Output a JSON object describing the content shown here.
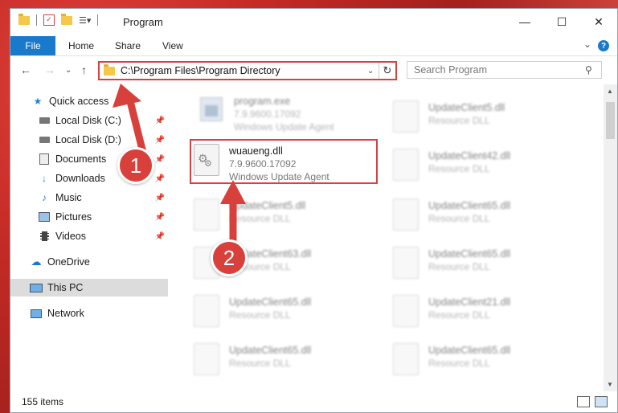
{
  "window": {
    "title": "Program"
  },
  "ribbon": {
    "file": "File",
    "home": "Home",
    "share": "Share",
    "view": "View",
    "help": "?"
  },
  "address": {
    "path": "C:\\Program Files\\Program Directory"
  },
  "search": {
    "placeholder": "Search Program"
  },
  "sidebar": {
    "items": [
      {
        "label": "Quick access"
      },
      {
        "label": "Local Disk (C:)"
      },
      {
        "label": "Local Disk (D:)"
      },
      {
        "label": "Documents"
      },
      {
        "label": "Downloads"
      },
      {
        "label": "Music"
      },
      {
        "label": "Pictures"
      },
      {
        "label": "Videos"
      },
      {
        "label": "OneDrive"
      },
      {
        "label": "This PC"
      },
      {
        "label": "Network"
      }
    ]
  },
  "files": {
    "left": [
      {
        "name": "program.exe",
        "line2": "7.9.9600.17092",
        "line3": "Windows Update Agent"
      },
      {
        "name": "wuaueng.dll",
        "line2": "7.9.9600.17092",
        "line3": "Windows Update Agent"
      },
      {
        "name": "UpdateClient5.dll",
        "line2": "Resource DLL"
      },
      {
        "name": "UpdateClient63.dll",
        "line2": "Resource DLL"
      },
      {
        "name": "UpdateClient65.dll",
        "line2": "Resource DLL"
      },
      {
        "name": "UpdateClient65.dll",
        "line2": "Resource DLL"
      }
    ],
    "right": [
      {
        "name": "UpdateClient5.dll",
        "line2": "Resource DLL"
      },
      {
        "name": "UpdateClient42.dll",
        "line2": "Resource DLL"
      },
      {
        "name": "UpdateClient65.dll",
        "line2": "Resource DLL"
      },
      {
        "name": "UpdateClient65.dll",
        "line2": "Resource DLL"
      },
      {
        "name": "UpdateClient21.dll",
        "line2": "Resource DLL"
      },
      {
        "name": "UpdateClient65.dll",
        "line2": "Resource DLL"
      }
    ]
  },
  "status": {
    "count": "155 items"
  },
  "annotations": {
    "step1": "1",
    "step2": "2"
  },
  "colors": {
    "accent": "#1979ca",
    "highlight": "#d94040",
    "folder": "#f3c84b"
  }
}
